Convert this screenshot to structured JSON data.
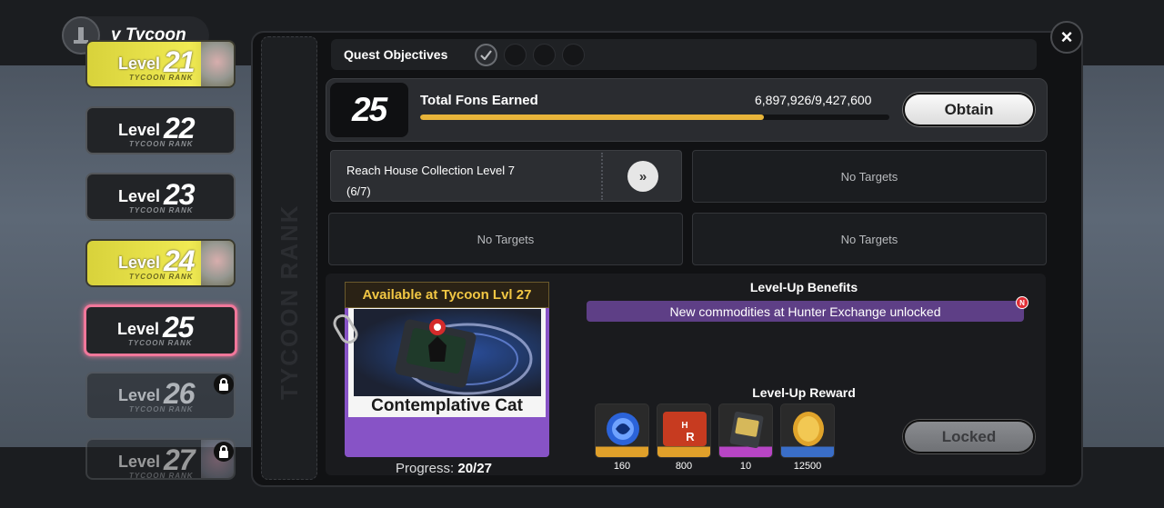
{
  "header": {
    "title": "y Tycoon"
  },
  "levels": [
    {
      "word": "Level",
      "num": "21",
      "sub": "TYCOON RANK",
      "state": "done"
    },
    {
      "word": "Level",
      "num": "22",
      "sub": "TYCOON RANK",
      "state": "normal"
    },
    {
      "word": "Level",
      "num": "23",
      "sub": "TYCOON RANK",
      "state": "normal"
    },
    {
      "word": "Level",
      "num": "24",
      "sub": "TYCOON RANK",
      "state": "done"
    },
    {
      "word": "Level",
      "num": "25",
      "sub": "TYCOON RANK",
      "state": "current"
    },
    {
      "word": "Level",
      "num": "26",
      "sub": "TYCOON RANK",
      "state": "locked"
    },
    {
      "word": "Level",
      "num": "27",
      "sub": "TYCOON RANK",
      "state": "locked"
    }
  ],
  "spine_text": "TYCOON RANK",
  "quest": {
    "title": "Quest Objectives",
    "completed": 1,
    "total": 4
  },
  "fons": {
    "level": "25",
    "label": "Total Fons Earned",
    "value": "6,897,926/9,427,600",
    "progress": 0.7317,
    "obtain_label": "Obtain"
  },
  "targets": {
    "active_line1": "Reach House Collection Level 7",
    "active_line2": "(6/7)",
    "go_label": "»",
    "empty1": "No Targets",
    "empty2": "No Targets",
    "empty3": "No Targets"
  },
  "reward_card": {
    "available": "Available at Tycoon Lvl 27",
    "name": "Contemplative Cat",
    "progress_label": "Progress:",
    "progress_value": "20/27"
  },
  "benefits": {
    "title": "Level-Up Benefits",
    "item": "New commodities at Hunter Exchange unlocked",
    "badge": "N"
  },
  "rewards": {
    "title": "Level-Up Reward",
    "items": [
      {
        "icon": "polychrome-icon",
        "qty": "160",
        "color": "#e0a02a"
      },
      {
        "icon": "hunter-rewards-icon",
        "qty": "800",
        "color": "#e0a02a"
      },
      {
        "icon": "bangboo-tape-icon",
        "qty": "10",
        "color": "#b845c5"
      },
      {
        "icon": "dennies-coin-icon",
        "qty": "12500",
        "color": "#3a6ec8"
      }
    ],
    "locked_label": "Locked"
  },
  "close_label": "×",
  "colors": {
    "accent_gold": "#e8b53a",
    "current_border": "#f0779a",
    "purple": "#8753c6"
  }
}
